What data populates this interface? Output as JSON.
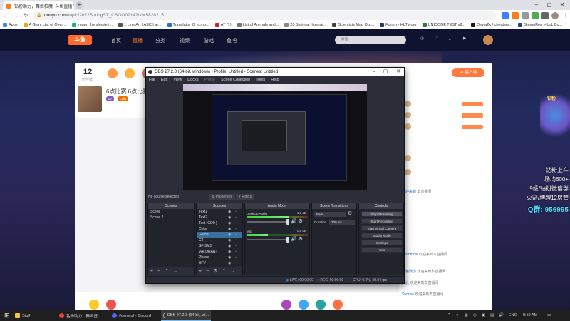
{
  "browser": {
    "tabs": [
      {
        "title": "钻粉助力，舞姬狂魔_斗鱼直播平",
        "active": true
      },
      {
        "title": "",
        "active": false
      }
    ],
    "address": {
      "host": "douyu.com",
      "path": "/topic/2022SpringST_CSGO0214?rid=5820215"
    },
    "bookmarks": [
      "Apps",
      "A Giant List of Over...",
      "Imgur: the simple i...",
      "1 Line Art | ASCII ar...",
      "Translator @ ecmo...",
      "AT (1)",
      "List of Animals and...",
      "20 Satirical Illustrat...",
      "Scientists Map Out...",
      "Forum - HLTV.org",
      "UNICODE TEST v8...",
      "Devia2k / cheaters...",
      "SteamRep » LoL Bo..."
    ]
  },
  "site": {
    "logo": "斗鱼",
    "nav": [
      "首页",
      "直播",
      "分类",
      "视频",
      "游戏",
      "鱼吧"
    ],
    "search_placeholder": "搜索",
    "viewers": "12",
    "viewers_sub": "粉丝牌",
    "pc_button": "PC客户端",
    "room_title": "6点比赛 6点比赛",
    "tags": [
      "LV",
      "Lvlio"
    ],
    "chat": [
      {
        "name": "欢迎来到",
        "text": " 本直播间"
      },
      {
        "name": "Cyanmoai",
        "text": " 欢迎来到本直播间"
      },
      {
        "name": "牛骗我小",
        "text": " 欢迎来到本直播间"
      },
      {
        "name": "如此",
        "text": " 欢迎来到本直播间"
      },
      {
        "name": "Sunrise",
        "text": " 欢迎来到本直播间"
      }
    ],
    "promo": [
      "钻粉上车",
      "场均600+",
      "9级/钻粉微信群",
      "火箭/牌牌12房管",
      "Q群: 956995"
    ],
    "promo_badge": "钻粉"
  },
  "obs": {
    "title": "OBS 27.2.3 (64-bit, windows) - Profile: Untitled - Scenes: Untitled",
    "menu": [
      {
        "label": "File",
        "disabled": false
      },
      {
        "label": "Edit",
        "disabled": false
      },
      {
        "label": "View",
        "disabled": false
      },
      {
        "label": "Docks",
        "disabled": false
      },
      {
        "label": "Profile",
        "disabled": true
      },
      {
        "label": "Scene Collection",
        "disabled": false
      },
      {
        "label": "Tools",
        "disabled": false
      },
      {
        "label": "Help",
        "disabled": false
      }
    ],
    "no_source": "No source selected",
    "properties": "Properties",
    "filters": "Filters",
    "docks": {
      "scenes": {
        "title": "Scenes",
        "items": [
          "Scene",
          "Scene 2"
        ]
      },
      "sources": {
        "title": "Sources",
        "items": [
          "Text1",
          "Text2",
          "Text (GDI+)",
          "Color",
          "Game",
          "C4",
          "SF-SMS",
          "VALORANT",
          "Phase",
          "BFV",
          "Mfy"
        ]
      },
      "mixer": {
        "title": "Audio Mixer",
        "channels": [
          {
            "name": "Desktop Audio",
            "db": "-1.2 dB",
            "level": 0.7
          },
          {
            "name": "Mic",
            "db": "0.0 dB",
            "level": 0.35
          }
        ]
      },
      "transitions": {
        "title": "Scene Transitions",
        "type": "Fade",
        "duration_label": "Duration",
        "duration": "300 ms"
      },
      "controls": {
        "title": "Controls",
        "buttons": [
          "Stop Streaming",
          "Start Recording",
          "Start Virtual Camera",
          "Studio Mode",
          "Settings",
          "Exit"
        ]
      }
    },
    "status": {
      "live": "LIVE: 00:00:00",
      "rec": "REC: 00:00:00",
      "cpu": "CPU: 0.4%, 59.94 fps"
    }
  },
  "taskbar": {
    "items": [
      {
        "label": "Stuff",
        "active": false
      },
      {
        "label": "钻粉助力，舞姬狂...",
        "active": false
      },
      {
        "label": "#general - Discord",
        "active": false
      },
      {
        "label": "OBS 27.2.3 (64-bit, wi...",
        "active": true
      }
    ],
    "lang": "ENG",
    "time": "9:59 AM"
  },
  "colors": {
    "accent": "#ff7a1a",
    "obs_bg": "#2b2e38",
    "obs_select": "#3b6f9e"
  }
}
